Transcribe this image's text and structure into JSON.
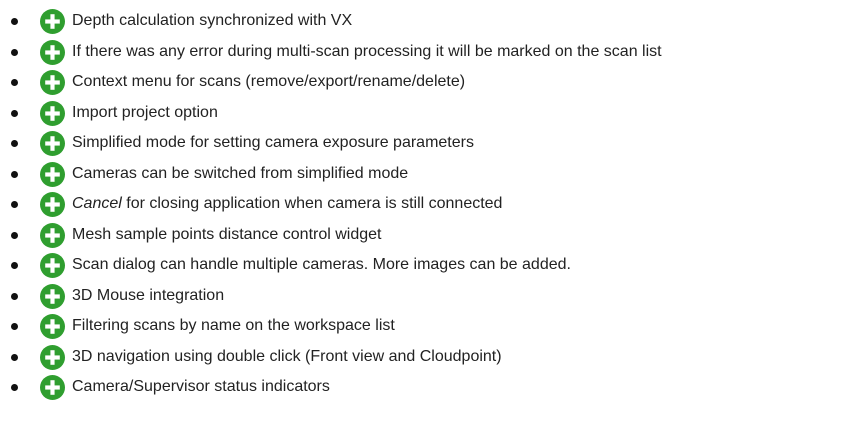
{
  "icon": {
    "name": "plus-icon",
    "color": "#2f9e2f"
  },
  "items": [
    {
      "text": "Depth calculation synchronized with VX"
    },
    {
      "text": "If there was any error during multi-scan processing it will be marked on the scan list"
    },
    {
      "text": "Context menu for scans (remove/export/rename/delete)"
    },
    {
      "text": "Import project option"
    },
    {
      "text": "Simplified mode for setting camera exposure parameters"
    },
    {
      "text": "Cameras can be switched from simplified mode"
    },
    {
      "emph": "Cancel",
      "text": " for closing application when camera is still connected"
    },
    {
      "text": "Mesh sample points distance control widget"
    },
    {
      "text": "Scan dialog can handle multiple cameras. More images can be added."
    },
    {
      "text": "3D Mouse integration"
    },
    {
      "text": "Filtering scans by name on the workspace list"
    },
    {
      "text": "3D navigation using double click (Front view and Cloudpoint)"
    },
    {
      "text": "Camera/Supervisor status indicators"
    }
  ]
}
